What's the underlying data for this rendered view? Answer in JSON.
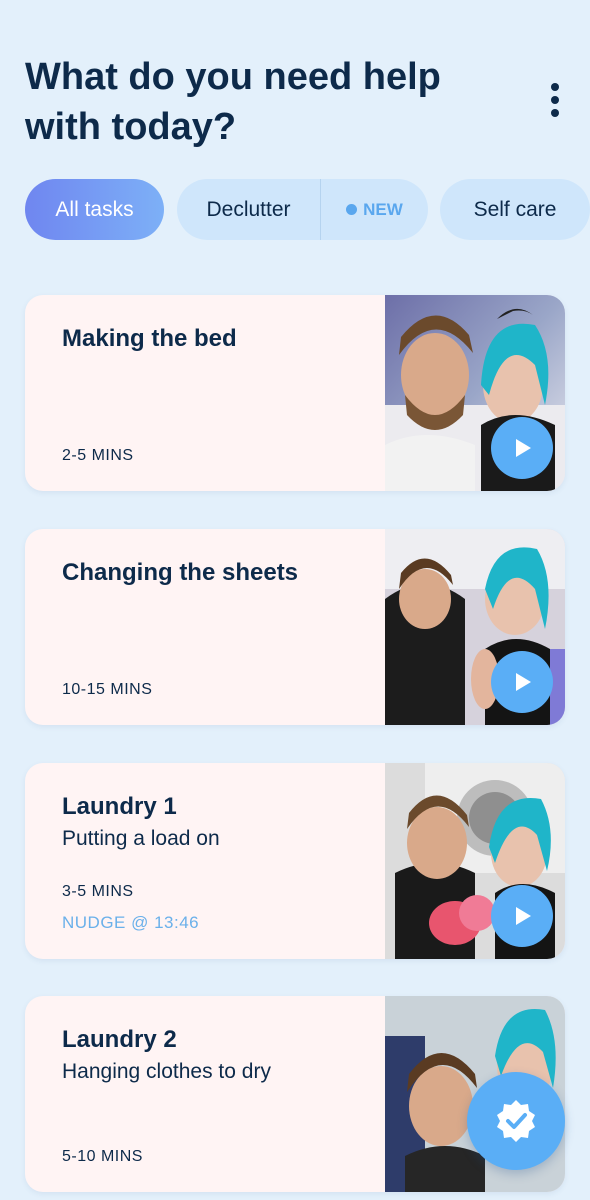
{
  "header": {
    "title": "What do you need help with today?"
  },
  "filters": {
    "all": "All tasks",
    "declutter": "Declutter",
    "new_badge": "NEW",
    "self_care": "Self care"
  },
  "tasks": [
    {
      "title": "Making the bed",
      "subtitle": "",
      "duration": "2-5 MINS",
      "nudge": "",
      "thumbnail_icon": "video-thumbnail-making-bed"
    },
    {
      "title": "Changing the sheets",
      "subtitle": "",
      "duration": "10-15 MINS",
      "nudge": "",
      "thumbnail_icon": "video-thumbnail-changing-sheets"
    },
    {
      "title": "Laundry 1",
      "subtitle": "Putting a load on",
      "duration": "3-5 MINS",
      "nudge": "NUDGE @ 13:46",
      "thumbnail_icon": "video-thumbnail-laundry-1"
    },
    {
      "title": "Laundry 2",
      "subtitle": "Hanging clothes to dry",
      "duration": "5-10 MINS",
      "nudge": "",
      "thumbnail_icon": "video-thumbnail-laundry-2"
    }
  ],
  "icons": {
    "menu": "more-vert-icon",
    "play": "play-icon",
    "fab": "verified-badge-icon"
  },
  "colors": {
    "background": "#e3f0fb",
    "accent": "#5aaef6",
    "chip_active_start": "#6f86f0",
    "chip_active_end": "#7db0f7",
    "chip_inactive": "#cfe6fb",
    "card_background": "#fff4f4",
    "text_primary": "#0d2a4a",
    "nudge_text": "#6ab0ea"
  }
}
